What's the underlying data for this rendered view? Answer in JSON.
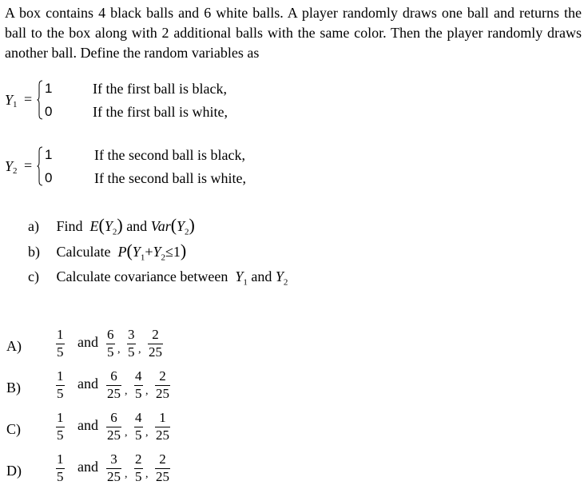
{
  "problem": {
    "intro": "A box contains 4 black balls and 6 white balls. A player randomly draws one ball and returns the ball to the box along with 2 additional balls with the same color. Then the player randomly draws another ball. Define the random variables as",
    "definitions": [
      {
        "var": "Y",
        "sub": "1",
        "eq": "=",
        "value_1": "1",
        "case_1": "If the first ball is black,",
        "value_0": "0",
        "case_0": "If the first ball is white,"
      },
      {
        "var": "Y",
        "sub": "2",
        "eq": "=",
        "value_1": "1",
        "case_1": "If the second ball is black,",
        "value_0": "0",
        "case_0": "If the second ball is white,"
      }
    ],
    "parts": [
      {
        "label": "a)",
        "text1": "Find",
        "expr1_fn": "E",
        "expr1_var": "Y",
        "expr1_sub": "2",
        "text2": "and",
        "expr2_fn": "Var",
        "expr2_var": "Y",
        "expr2_sub": "2"
      },
      {
        "label": "b)",
        "text1": "Calculate",
        "fn": "P",
        "var1": "Y",
        "sub1": "1",
        "plus": "+",
        "var2": "Y",
        "sub2": "2",
        "rel": "≤",
        "bound": "1"
      },
      {
        "label": "c)",
        "text1": "Calculate covariance between",
        "var1": "Y",
        "sub1": "1",
        "and": "and",
        "var2": "Y",
        "sub2": "2"
      }
    ]
  },
  "options": [
    {
      "label": "A)",
      "first": {
        "num": "1",
        "den": "5"
      },
      "and": "and",
      "fracs": [
        {
          "num": "6",
          "den": "5"
        },
        {
          "num": "3",
          "den": "5"
        },
        {
          "num": "2",
          "den": "25"
        }
      ],
      "sep": ","
    },
    {
      "label": "B)",
      "first": {
        "num": "1",
        "den": "5"
      },
      "and": "and",
      "fracs": [
        {
          "num": "6",
          "den": "25"
        },
        {
          "num": "4",
          "den": "5"
        },
        {
          "num": "2",
          "den": "25"
        }
      ],
      "sep": ","
    },
    {
      "label": "C)",
      "first": {
        "num": "1",
        "den": "5"
      },
      "and": "and",
      "fracs": [
        {
          "num": "6",
          "den": "25"
        },
        {
          "num": "4",
          "den": "5"
        },
        {
          "num": "1",
          "den": "25"
        }
      ],
      "sep": ","
    },
    {
      "label": "D)",
      "first": {
        "num": "1",
        "den": "5"
      },
      "and": "and",
      "fracs": [
        {
          "num": "3",
          "den": "25"
        },
        {
          "num": "2",
          "den": "5"
        },
        {
          "num": "2",
          "den": "25"
        }
      ],
      "sep": ","
    }
  ]
}
